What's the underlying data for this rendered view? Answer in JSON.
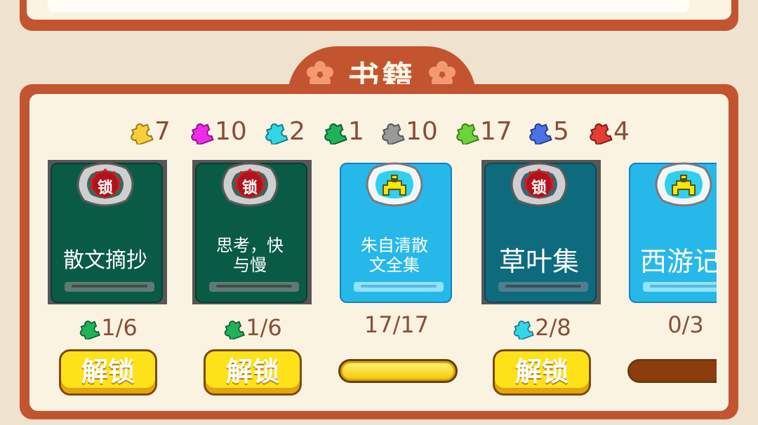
{
  "title": "书籍",
  "puzzle_counts": [
    {
      "color": "#f7cf3b",
      "value": "7"
    },
    {
      "color": "#ee2be9",
      "value": "10"
    },
    {
      "color": "#33d6e5",
      "value": "2"
    },
    {
      "color": "#20b257",
      "value": "1"
    },
    {
      "color": "#9a9a9a",
      "value": "10"
    },
    {
      "color": "#6ed33b",
      "value": "17"
    },
    {
      "color": "#4a74e6",
      "value": "5"
    },
    {
      "color": "#e53d36",
      "value": "4"
    }
  ],
  "books": [
    {
      "title": "散文摘抄",
      "locked": true,
      "lock_label": "锁",
      "progress": "1/6",
      "progress_icon_color": "#20b257",
      "button": "解锁"
    },
    {
      "title": "思考，快与慢",
      "locked": true,
      "lock_label": "锁",
      "progress": "1/6",
      "progress_icon_color": "#20b257",
      "button": "解锁"
    },
    {
      "title": "朱自清散文全集",
      "locked": false,
      "progress": "17/17",
      "progress_fraction": 1.0
    },
    {
      "title": "草叶集",
      "locked": true,
      "lock_label": "锁",
      "progress": "2/8",
      "progress_icon_color": "#33d6e5",
      "button": "解锁"
    },
    {
      "title": "西游记",
      "locked": false,
      "progress": "0/3",
      "progress_fraction": 0.0
    }
  ]
}
